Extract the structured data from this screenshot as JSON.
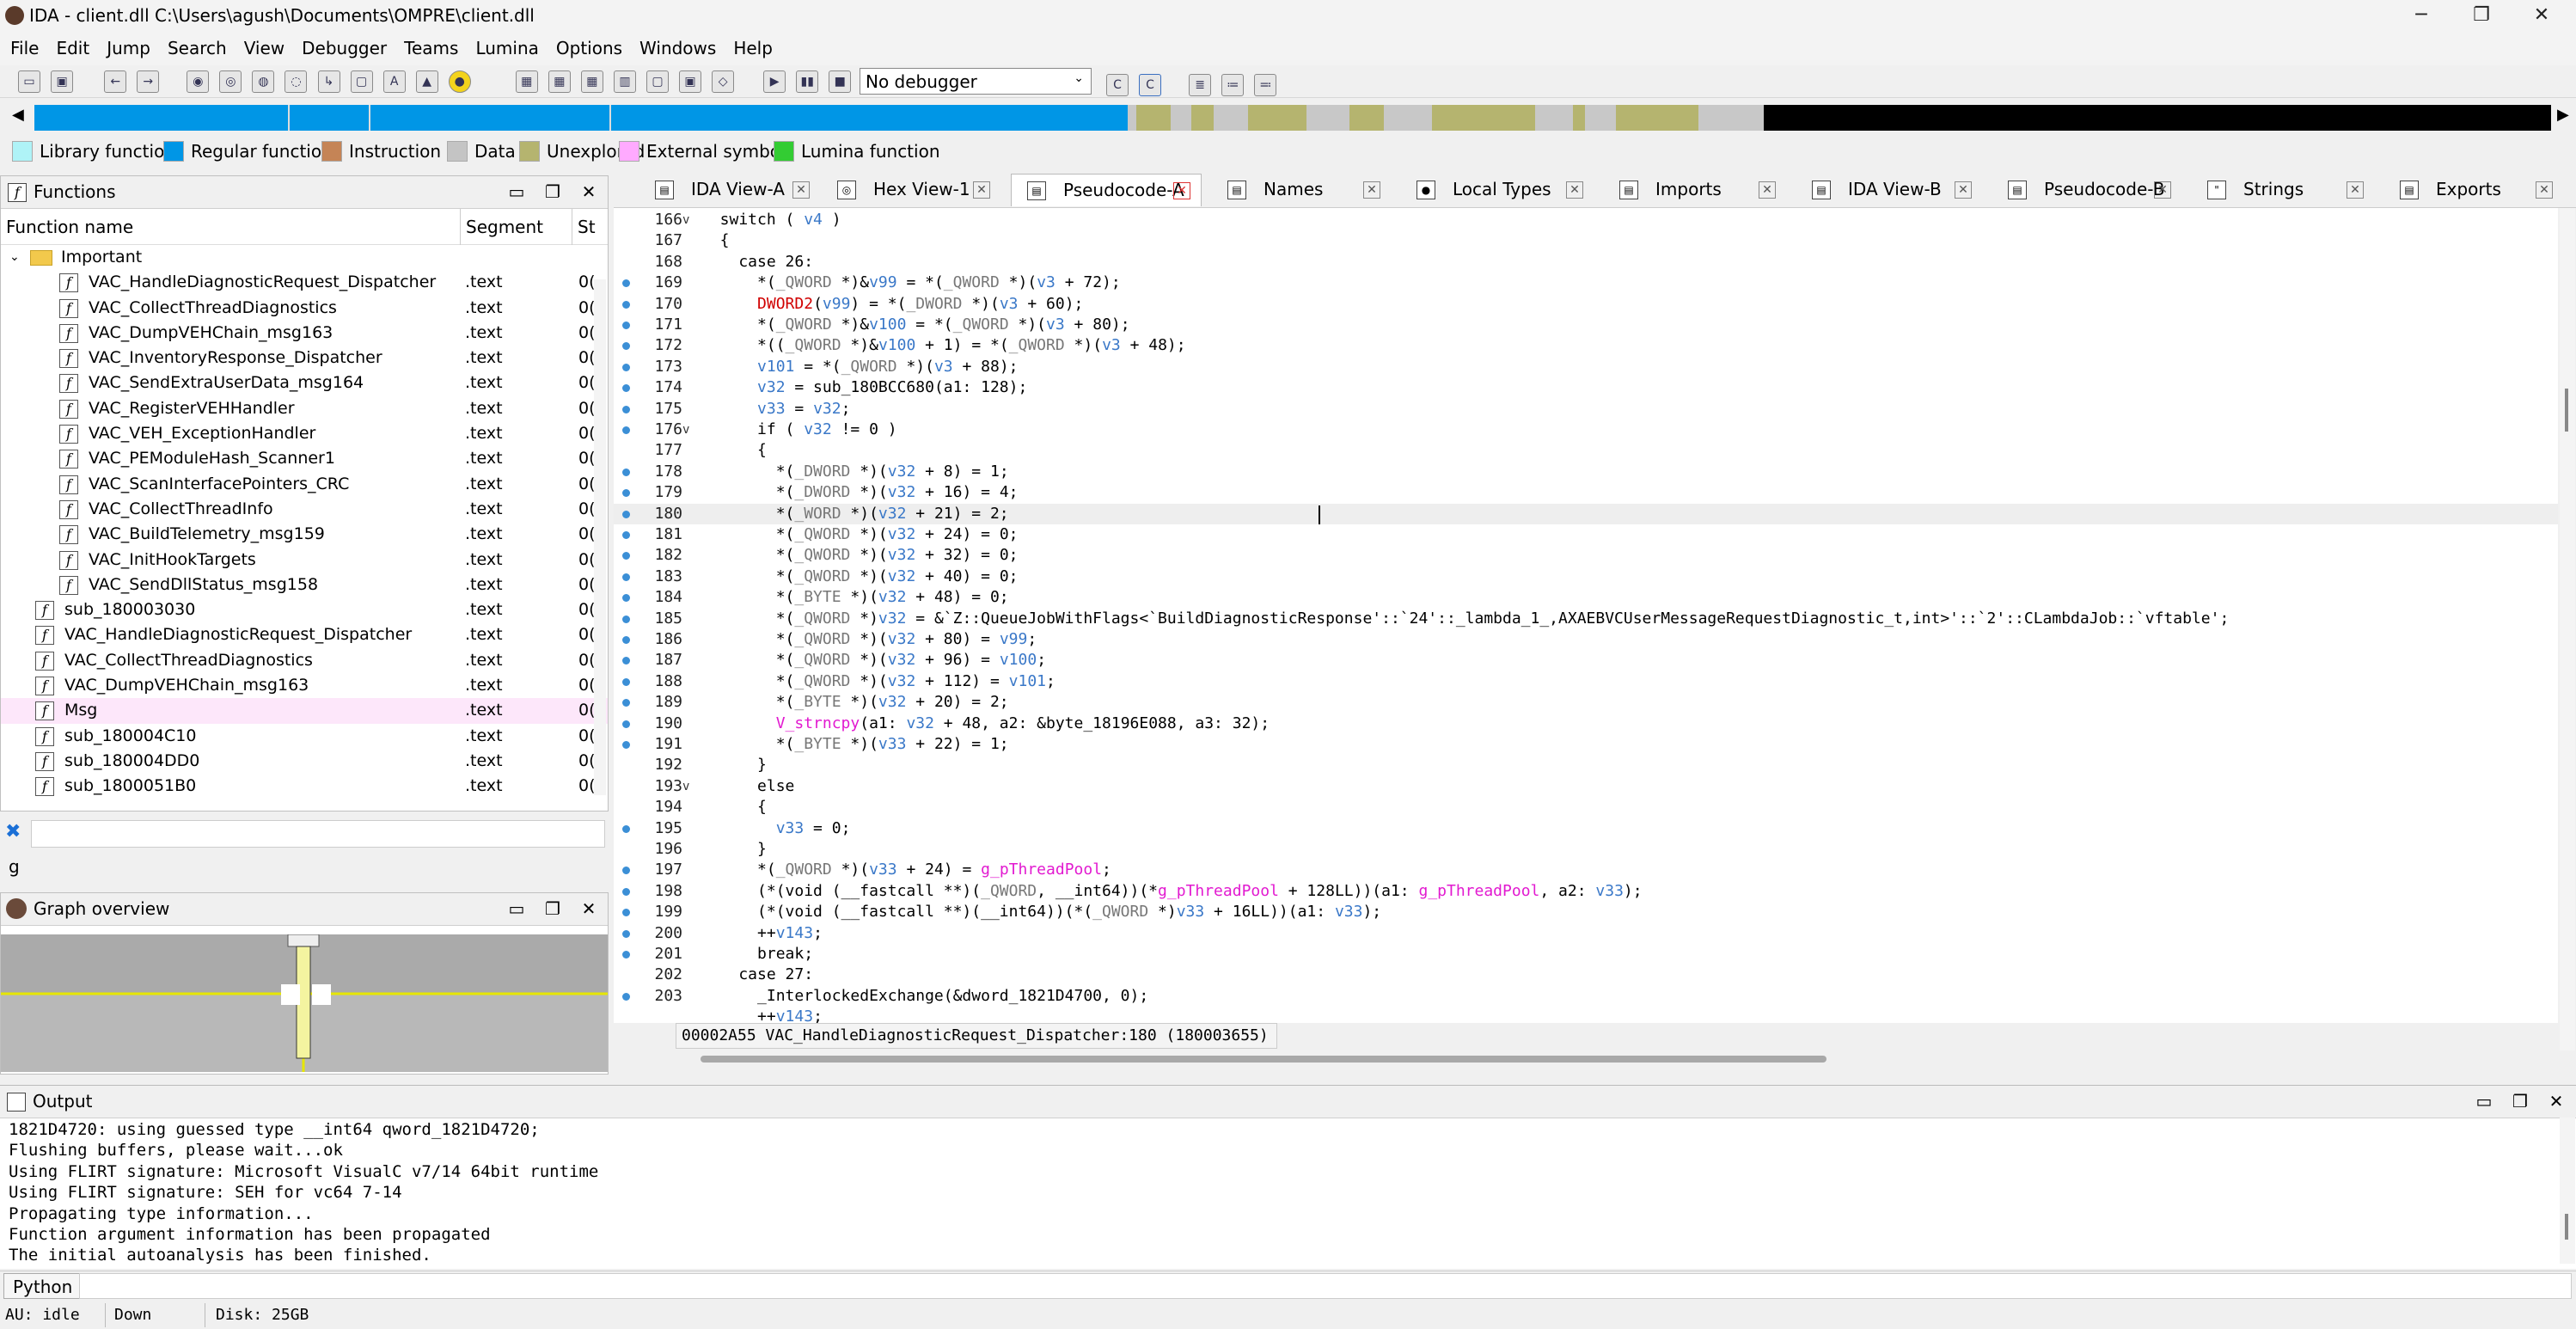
{
  "window": {
    "title": "IDA - client.dll C:\\Users\\agush\\Documents\\OMPRE\\client.dll",
    "minimize": "─",
    "maximize": "❐",
    "close": "✕"
  },
  "menu": [
    "File",
    "Edit",
    "Jump",
    "Search",
    "View",
    "Debugger",
    "Teams",
    "Lumina",
    "Options",
    "Windows",
    "Help"
  ],
  "toolbar": {
    "debugger": "No debugger"
  },
  "legend": [
    {
      "label": "Library function",
      "color": "#aff3f7"
    },
    {
      "label": "Regular function",
      "color": "#0096e6"
    },
    {
      "label": "Instruction",
      "color": "#c58456"
    },
    {
      "label": "Data",
      "color": "#c4c4c4"
    },
    {
      "label": "Unexplored",
      "color": "#b5b46f"
    },
    {
      "label": "External symbol",
      "color": "#ffaaff"
    },
    {
      "label": "Lumina function",
      "color": "#33cc33"
    }
  ],
  "functions": {
    "title": "Functions",
    "columns": [
      "Function name",
      "Segment",
      "St"
    ],
    "folder": "Important",
    "rows": [
      {
        "name": "VAC_HandleDiagnosticRequest_Dispatcher",
        "seg": ".text",
        "st": "0(",
        "indent": 1
      },
      {
        "name": "VAC_CollectThreadDiagnostics",
        "seg": ".text",
        "st": "0(",
        "indent": 1
      },
      {
        "name": "VAC_DumpVEHChain_msg163",
        "seg": ".text",
        "st": "0(",
        "indent": 1
      },
      {
        "name": "VAC_InventoryResponse_Dispatcher",
        "seg": ".text",
        "st": "0(",
        "indent": 1
      },
      {
        "name": "VAC_SendExtraUserData_msg164",
        "seg": ".text",
        "st": "0(",
        "indent": 1
      },
      {
        "name": "VAC_RegisterVEHHandler",
        "seg": ".text",
        "st": "0(",
        "indent": 1
      },
      {
        "name": "VAC_VEH_ExceptionHandler",
        "seg": ".text",
        "st": "0(",
        "indent": 1
      },
      {
        "name": "VAC_PEModuleHash_Scanner1",
        "seg": ".text",
        "st": "0(",
        "indent": 1
      },
      {
        "name": "VAC_ScanInterfacePointers_CRC",
        "seg": ".text",
        "st": "0(",
        "indent": 1
      },
      {
        "name": "VAC_CollectThreadInfo",
        "seg": ".text",
        "st": "0(",
        "indent": 1
      },
      {
        "name": "VAC_BuildTelemetry_msg159",
        "seg": ".text",
        "st": "0(",
        "indent": 1
      },
      {
        "name": "VAC_InitHookTargets",
        "seg": ".text",
        "st": "0(",
        "indent": 1
      },
      {
        "name": "VAC_SendDllStatus_msg158",
        "seg": ".text",
        "st": "0(",
        "indent": 1
      },
      {
        "name": "sub_180003030",
        "seg": ".text",
        "st": "0(",
        "indent": 0
      },
      {
        "name": "VAC_HandleDiagnosticRequest_Dispatcher",
        "seg": ".text",
        "st": "0(",
        "indent": 0
      },
      {
        "name": "VAC_CollectThreadDiagnostics",
        "seg": ".text",
        "st": "0(",
        "indent": 0
      },
      {
        "name": "VAC_DumpVEHChain_msg163",
        "seg": ".text",
        "st": "0(",
        "indent": 0
      },
      {
        "name": "Msg",
        "seg": ".text",
        "st": "0(",
        "indent": 0,
        "highlight": true
      },
      {
        "name": "sub_180004C10",
        "seg": ".text",
        "st": "0(",
        "indent": 0
      },
      {
        "name": "sub_180004DD0",
        "seg": ".text",
        "st": "0(",
        "indent": 0
      },
      {
        "name": "sub_1800051B0",
        "seg": ".text",
        "st": "0(",
        "indent": 0
      }
    ]
  },
  "search": {
    "value": "g"
  },
  "graph": {
    "title": "Graph overview"
  },
  "tabs": [
    {
      "label": "IDA View-A",
      "icon": "▤"
    },
    {
      "label": "Hex View-1",
      "icon": "◎"
    },
    {
      "label": "Pseudocode-A",
      "icon": "▤",
      "active": true
    },
    {
      "label": "Names",
      "icon": "▤"
    },
    {
      "label": "Local Types",
      "icon": "●"
    },
    {
      "label": "Imports",
      "icon": "▤"
    },
    {
      "label": "IDA View-B",
      "icon": "▤"
    },
    {
      "label": "Pseudocode-B",
      "icon": "▤"
    },
    {
      "label": "Strings",
      "icon": "\""
    },
    {
      "label": "Exports",
      "icon": "▤"
    }
  ],
  "code": [
    {
      "n": "166",
      "dot": false,
      "fold": "v",
      "t": "  switch ( v4 )"
    },
    {
      "n": "167",
      "dot": false,
      "fold": "",
      "t": "  {"
    },
    {
      "n": "168",
      "dot": false,
      "fold": "",
      "t": "    case 26:"
    },
    {
      "n": "169",
      "dot": true,
      "fold": "",
      "t": "      *(_QWORD *)&v99 = *(_QWORD *)(v3 + 72);"
    },
    {
      "n": "170",
      "dot": true,
      "fold": "",
      "t": "      DWORD2(v99) = *(_DWORD *)(v3 + 60);"
    },
    {
      "n": "171",
      "dot": true,
      "fold": "",
      "t": "      *(_QWORD *)&v100 = *(_QWORD *)(v3 + 80);"
    },
    {
      "n": "172",
      "dot": true,
      "fold": "",
      "t": "      *((_QWORD *)&v100 + 1) = *(_QWORD *)(v3 + 48);"
    },
    {
      "n": "173",
      "dot": true,
      "fold": "",
      "t": "      v101 = *(_QWORD *)(v3 + 88);"
    },
    {
      "n": "174",
      "dot": true,
      "fold": "",
      "t": "      v32 = sub_180BCC680(a1: 128);"
    },
    {
      "n": "175",
      "dot": true,
      "fold": "",
      "t": "      v33 = v32;"
    },
    {
      "n": "176",
      "dot": true,
      "fold": "v",
      "t": "      if ( v32 != 0 )"
    },
    {
      "n": "177",
      "dot": false,
      "fold": "",
      "t": "      {"
    },
    {
      "n": "178",
      "dot": true,
      "fold": "",
      "t": "        *(_DWORD *)(v32 + 8) = 1;"
    },
    {
      "n": "179",
      "dot": true,
      "fold": "",
      "t": "        *(_DWORD *)(v32 + 16) = 4;"
    },
    {
      "n": "180",
      "dot": true,
      "fold": "",
      "t": "        *(_WORD *)(v32 + 21) = 2;",
      "hl": true
    },
    {
      "n": "181",
      "dot": true,
      "fold": "",
      "t": "        *(_QWORD *)(v32 + 24) = 0;"
    },
    {
      "n": "182",
      "dot": true,
      "fold": "",
      "t": "        *(_QWORD *)(v32 + 32) = 0;"
    },
    {
      "n": "183",
      "dot": true,
      "fold": "",
      "t": "        *(_QWORD *)(v32 + 40) = 0;"
    },
    {
      "n": "184",
      "dot": true,
      "fold": "",
      "t": "        *(_BYTE *)(v32 + 48) = 0;"
    },
    {
      "n": "185",
      "dot": true,
      "fold": "",
      "t": "        *(_QWORD *)v32 = &`Z::QueueJobWithFlags<`BuildDiagnosticResponse'::`24'::_lambda_1_,AXAEBVCUserMessageRequestDiagnostic_t,int>'::`2'::CLambdaJob::`vftable';"
    },
    {
      "n": "186",
      "dot": true,
      "fold": "",
      "t": "        *(_QWORD *)(v32 + 80) = v99;"
    },
    {
      "n": "187",
      "dot": true,
      "fold": "",
      "t": "        *(_QWORD *)(v32 + 96) = v100;"
    },
    {
      "n": "188",
      "dot": true,
      "fold": "",
      "t": "        *(_QWORD *)(v32 + 112) = v101;"
    },
    {
      "n": "189",
      "dot": true,
      "fold": "",
      "t": "        *(_BYTE *)(v32 + 20) = 2;"
    },
    {
      "n": "190",
      "dot": true,
      "fold": "",
      "t": "        V_strncpy(a1: v32 + 48, a2: &byte_18196E088, a3: 32);"
    },
    {
      "n": "191",
      "dot": true,
      "fold": "",
      "t": "        *(_BYTE *)(v33 + 22) = 1;"
    },
    {
      "n": "192",
      "dot": false,
      "fold": "",
      "t": "      }"
    },
    {
      "n": "193",
      "dot": false,
      "fold": "v",
      "t": "      else"
    },
    {
      "n": "194",
      "dot": false,
      "fold": "",
      "t": "      {"
    },
    {
      "n": "195",
      "dot": true,
      "fold": "",
      "t": "        v33 = 0;"
    },
    {
      "n": "196",
      "dot": false,
      "fold": "",
      "t": "      }"
    },
    {
      "n": "197",
      "dot": true,
      "fold": "",
      "t": "      *(_QWORD *)(v33 + 24) = g_pThreadPool;"
    },
    {
      "n": "198",
      "dot": true,
      "fold": "",
      "t": "      (*(void (__fastcall **)(_QWORD, __int64))(*g_pThreadPool + 128LL))(a1: g_pThreadPool, a2: v33);"
    },
    {
      "n": "199",
      "dot": true,
      "fold": "",
      "t": "      (*(void (__fastcall **)(__int64))(*(_QWORD *)v33 + 16LL))(a1: v33);"
    },
    {
      "n": "200",
      "dot": true,
      "fold": "",
      "t": "      ++v143;"
    },
    {
      "n": "201",
      "dot": true,
      "fold": "",
      "t": "      break;"
    },
    {
      "n": "202",
      "dot": false,
      "fold": "",
      "t": "    case 27:"
    },
    {
      "n": "203",
      "dot": true,
      "fold": "",
      "t": "      _InterlockedExchange(&dword_1821D4700, 0);"
    },
    {
      "n": "",
      "dot": false,
      "fold": "",
      "t": "      ++v143;"
    }
  ],
  "code_status": "00002A55 VAC_HandleDiagnosticRequest_Dispatcher:180 (180003655)",
  "output": {
    "title": "Output",
    "lines": [
      "1821D4720: using guessed type __int64 qword_1821D4720;",
      "Flushing buffers, please wait...ok",
      "Using FLIRT signature: Microsoft VisualC v7/14 64bit runtime",
      "Using FLIRT signature: SEH for vc64 7-14",
      "Propagating type information...",
      "Function argument information has been propagated",
      "The initial autoanalysis has been finished."
    ]
  },
  "python_label": "Python",
  "status": {
    "au": "AU:  idle",
    "dir": "Down",
    "disk": "Disk: 25GB"
  }
}
